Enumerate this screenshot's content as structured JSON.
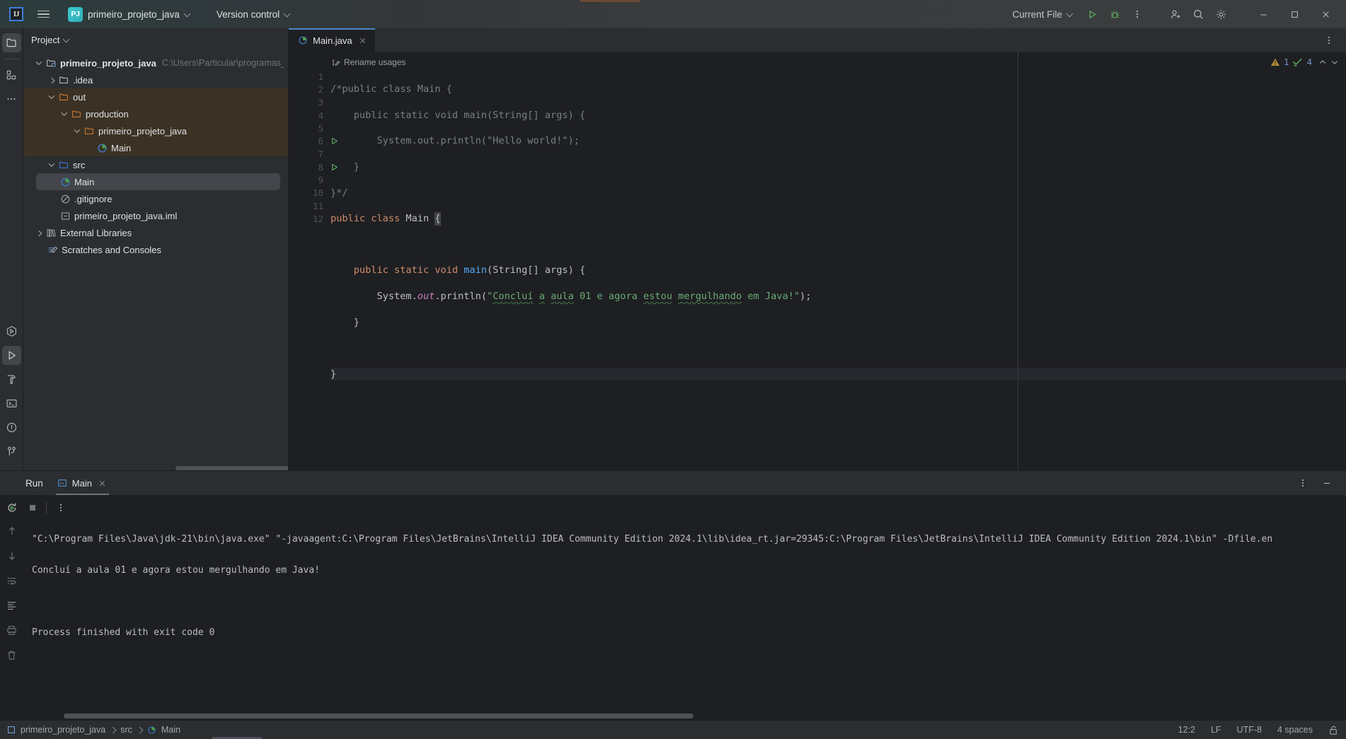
{
  "titlebar": {
    "logo": "ij-logo",
    "menu_icon": "hamburger-menu-icon",
    "project_badge": "PJ",
    "project_name": "primeiro_projeto_java",
    "version_control": "Version control",
    "run_config": "Current File",
    "run_icon": "run-icon",
    "debug_icon": "debug-icon",
    "more_icon": "more-vertical-icon",
    "add_user_icon": "add-user-icon",
    "search_icon": "search-icon",
    "settings_icon": "gear-icon",
    "minimize": "minimize-icon",
    "maximize": "maximize-icon",
    "close": "close-icon"
  },
  "rail": {
    "top": [
      {
        "name": "project-tool-window",
        "icon": "folder-icon",
        "active": true
      },
      {
        "name": "structure-tool-window",
        "icon": "structure-icon",
        "active": false
      },
      {
        "name": "more-tool-windows",
        "icon": "ellipsis-icon",
        "active": false
      }
    ],
    "bottom": [
      {
        "name": "run-anything",
        "icon": "run-hexagon-icon",
        "active": false
      },
      {
        "name": "run-tool-window",
        "icon": "run-triangle-icon",
        "active": true
      },
      {
        "name": "build-tool-window",
        "icon": "hammer-icon",
        "active": false
      },
      {
        "name": "terminal-tool-window",
        "icon": "terminal-icon",
        "active": false
      },
      {
        "name": "problems-tool-window",
        "icon": "warning-circle-icon",
        "active": false
      },
      {
        "name": "version-control-tool-window",
        "icon": "git-branch-icon",
        "active": false
      }
    ]
  },
  "project_panel": {
    "title": "Project",
    "tree": [
      {
        "label": "primeiro_projeto_java",
        "path": "C:\\Users\\Particular\\programas_Java\\primei",
        "depth": 0,
        "icon": "project-root-icon",
        "state": "open",
        "bold": true,
        "hl": "none"
      },
      {
        "label": ".idea",
        "path": "",
        "depth": 1,
        "icon": "folder-icon",
        "state": "closed",
        "bold": false,
        "hl": "none"
      },
      {
        "label": "out",
        "path": "",
        "depth": 1,
        "icon": "folder-excluded-icon",
        "state": "open",
        "bold": false,
        "hl": "out"
      },
      {
        "label": "production",
        "path": "",
        "depth": 2,
        "icon": "folder-excluded-icon",
        "state": "open",
        "bold": false,
        "hl": "out"
      },
      {
        "label": "primeiro_projeto_java",
        "path": "",
        "depth": 3,
        "icon": "folder-excluded-icon",
        "state": "open",
        "bold": false,
        "hl": "out"
      },
      {
        "label": "Main",
        "path": "",
        "depth": 4,
        "icon": "java-class-icon",
        "state": "leaf",
        "bold": false,
        "hl": "out"
      },
      {
        "label": "src",
        "path": "",
        "depth": 1,
        "icon": "folder-source-icon",
        "state": "open",
        "bold": false,
        "hl": "none"
      },
      {
        "label": "Main",
        "path": "",
        "depth": 2,
        "icon": "java-class-icon",
        "state": "leaf",
        "bold": false,
        "hl": "selected"
      },
      {
        "label": ".gitignore",
        "path": "",
        "depth": 1,
        "icon": "gitignore-icon",
        "state": "leaf",
        "bold": false,
        "hl": "none"
      },
      {
        "label": "primeiro_projeto_java.iml",
        "path": "",
        "depth": 1,
        "icon": "iml-file-icon",
        "state": "leaf",
        "bold": false,
        "hl": "none"
      },
      {
        "label": "External Libraries",
        "path": "",
        "depth": 0,
        "icon": "libraries-icon",
        "state": "closed",
        "bold": false,
        "hl": "none"
      },
      {
        "label": "Scratches and Consoles",
        "path": "",
        "depth": 0,
        "icon": "scratches-icon",
        "state": "leaf",
        "bold": false,
        "hl": "none"
      }
    ]
  },
  "editor": {
    "tab": {
      "label": "Main.java",
      "icon": "java-class-icon",
      "close_icon": "close-icon"
    },
    "options_icon": "more-vertical-icon",
    "hint": "Rename usages",
    "hint_icon": "rename-icon",
    "inspections": {
      "warning_icon": "warning-triangle-icon",
      "warning_count": "1",
      "ok_icon": "inspection-ok-icon",
      "ok_count": "4",
      "prev_icon": "chevron-up-icon",
      "next_icon": "chevron-down-icon"
    },
    "lines": [
      {
        "n": "1",
        "runnable": false
      },
      {
        "n": "2",
        "runnable": false
      },
      {
        "n": "3",
        "runnable": false
      },
      {
        "n": "4",
        "runnable": false
      },
      {
        "n": "5",
        "runnable": false
      },
      {
        "n": "6",
        "runnable": true
      },
      {
        "n": "7",
        "runnable": false
      },
      {
        "n": "8",
        "runnable": true
      },
      {
        "n": "9",
        "runnable": false
      },
      {
        "n": "10",
        "runnable": false
      },
      {
        "n": "11",
        "runnable": false
      },
      {
        "n": "12",
        "runnable": false
      }
    ],
    "code_text": [
      "/*public class Main {",
      "    public static void main(String[] args) {",
      "        System.out.println(\"Hello world!\");",
      "    }",
      "}*/",
      "public class Main {",
      "",
      "    public static void main(String[] args) {",
      "        System.out.println(\"Concluí a aula 01 e agora estou mergulhando em Java!\");",
      "    }",
      "",
      "}"
    ]
  },
  "run_panel": {
    "title": "Run",
    "tab": {
      "label": "Main",
      "icon": "console-icon",
      "close_icon": "close-icon"
    },
    "options_icon": "more-vertical-icon",
    "minimize_icon": "minimize-icon",
    "toolbar": [
      {
        "name": "rerun-button",
        "icon": "rerun-icon"
      },
      {
        "name": "stop-button",
        "icon": "stop-icon"
      },
      {
        "name": "more-run-options",
        "icon": "more-vertical-icon"
      }
    ],
    "rail": [
      {
        "name": "scroll-up-button",
        "icon": "arrow-up-icon"
      },
      {
        "name": "scroll-down-button",
        "icon": "arrow-down-icon"
      },
      {
        "name": "soft-wrap-button",
        "icon": "soft-wrap-icon"
      },
      {
        "name": "scroll-to-end-button",
        "icon": "scroll-end-icon"
      },
      {
        "name": "print-button",
        "icon": "print-icon"
      },
      {
        "name": "clear-all-button",
        "icon": "trash-icon"
      }
    ],
    "console": [
      "\"C:\\Program Files\\Java\\jdk-21\\bin\\java.exe\" \"-javaagent:C:\\Program Files\\JetBrains\\IntelliJ IDEA Community Edition 2024.1\\lib\\idea_rt.jar=29345:C:\\Program Files\\JetBrains\\IntelliJ IDEA Community Edition 2024.1\\bin\" -Dfile.en",
      "Concluí a aula 01 e agora estou mergulhando em Java!",
      "",
      "Process finished with exit code 0"
    ]
  },
  "statusbar": {
    "breadcrumb": [
      {
        "label": "primeiro_projeto_java",
        "icon": "module-icon"
      },
      {
        "label": "src",
        "icon": ""
      },
      {
        "label": "Main",
        "icon": "java-class-icon"
      }
    ],
    "caret": "12:2",
    "line_sep": "LF",
    "encoding": "UTF-8",
    "indent": "4 spaces",
    "lock_icon": "unlock-icon"
  },
  "colors": {
    "accent_blue": "#4a88c7",
    "keyword": "#cf8e6d",
    "string": "#6aab73",
    "comment": "#7a7e85",
    "method": "#56a8f5",
    "field": "#c77dbb",
    "excluded_row": "#3b3225",
    "bg_editor": "#1e1f22",
    "bg_panel": "#2b2d30"
  }
}
